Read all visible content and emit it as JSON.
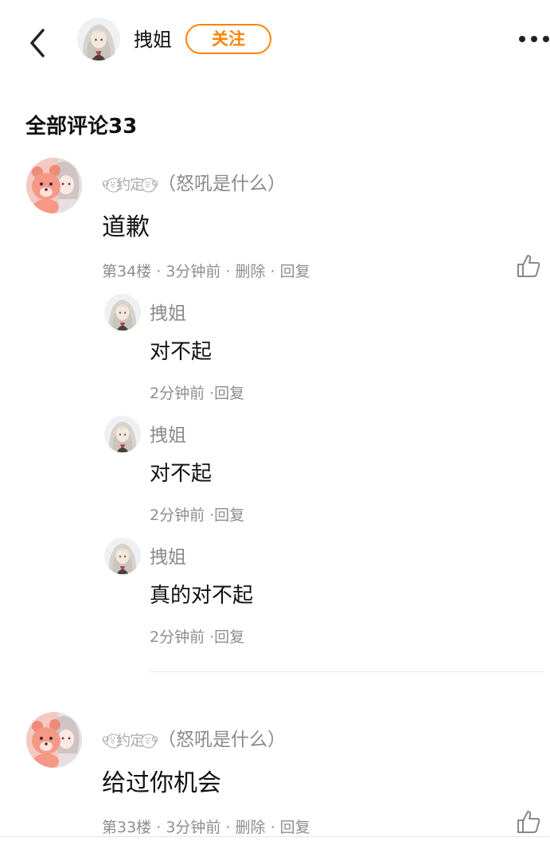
{
  "header": {
    "name": "拽姐",
    "follow_label": "关注"
  },
  "comments_title": "全部评论33",
  "comments": [
    {
      "username": "୧⍤⃝约定⍤⃝୨",
      "username_suffix": "（怒吼是什么）",
      "text": "道歉",
      "floor": "第34楼",
      "time": "3分钟前",
      "delete_label": "删除",
      "reply_label": "回复",
      "replies": [
        {
          "name": "拽姐",
          "text": "对不起",
          "time": "2分钟前",
          "reply_label": "·回复"
        },
        {
          "name": "拽姐",
          "text": "对不起",
          "time": "2分钟前",
          "reply_label": "·回复"
        },
        {
          "name": "拽姐",
          "text": "真的对不起",
          "time": "2分钟前",
          "reply_label": "·回复"
        }
      ]
    },
    {
      "username": "୧⍤⃝约定⍤⃝୨",
      "username_suffix": "（怒吼是什么）",
      "text": "给过你机会",
      "floor": "第33楼",
      "time": "3分钟前",
      "delete_label": "删除",
      "reply_label": "回复"
    }
  ],
  "separator": " · ",
  "colors": {
    "accent": "#ff8200",
    "muted": "#8e8e8e"
  }
}
